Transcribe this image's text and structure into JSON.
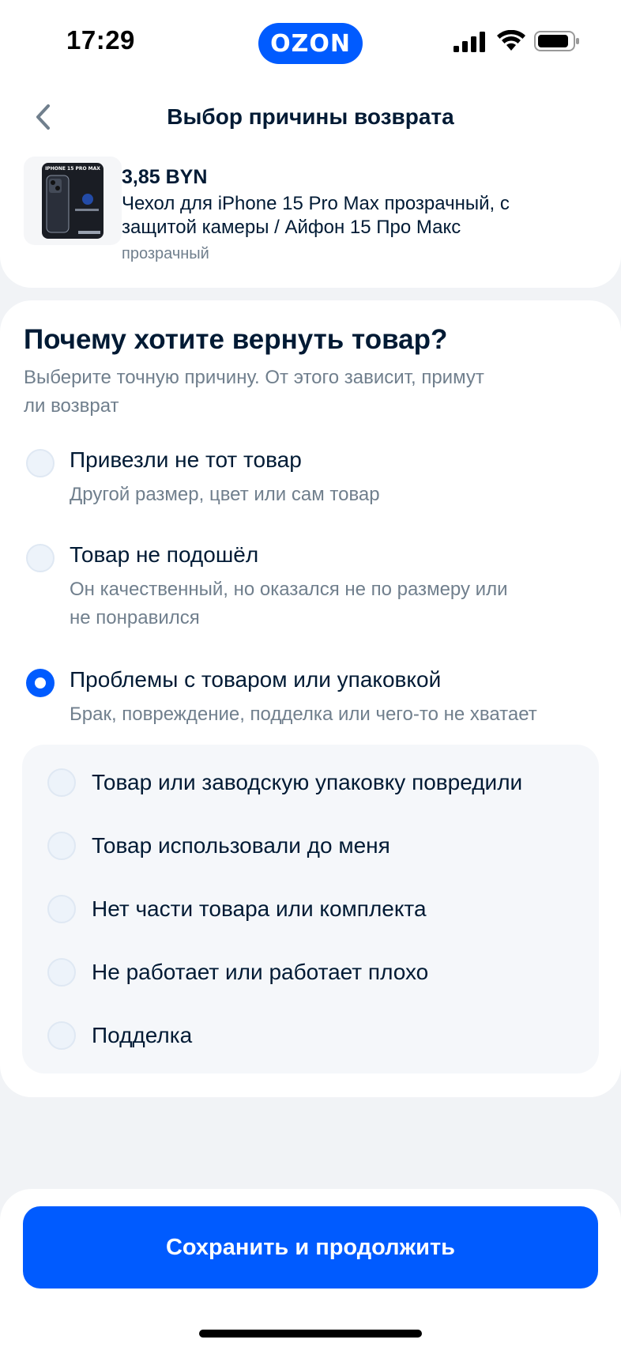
{
  "status_bar": {
    "time": "17:29",
    "brand": "OZON",
    "icons": [
      "signal-icon",
      "wifi-icon",
      "battery-icon"
    ]
  },
  "header": {
    "back_icon": "chevron-left-icon",
    "title": "Выбор причины возврата"
  },
  "product": {
    "price": "3,85 BYN",
    "name": "Чехол для iPhone 15 Pro Max прозрачный, с защитой камеры / Айфон 15 Про Макс",
    "variant": "прозрачный",
    "thumb_text": "IPHONE 15 PRO MAX"
  },
  "question": {
    "title": "Почему хотите вернуть товар?",
    "subtitle": "Выберите точную причину. От этого зависит, примут ли возврат",
    "options": [
      {
        "label": "Привезли не тот товар",
        "description": "Другой размер, цвет или сам товар",
        "selected": false
      },
      {
        "label": "Товар не подошёл",
        "description": "Он качественный, но оказался не по размеру или не понравился",
        "selected": false
      },
      {
        "label": "Проблемы с товаром или упаковкой",
        "description": "Брак, повреждение, подделка или чего-то не хватает",
        "selected": true
      }
    ],
    "sub_options": [
      {
        "label": "Товар или заводскую упаковку повредили"
      },
      {
        "label": "Товар использовали до меня"
      },
      {
        "label": "Нет части товара или комплекта"
      },
      {
        "label": "Не работает или работает плохо"
      },
      {
        "label": "Подделка"
      }
    ]
  },
  "footer": {
    "save_label": "Сохранить и продолжить"
  },
  "colors": {
    "accent": "#005bff",
    "text_primary": "#001a34",
    "text_secondary": "#707f8d",
    "background": "#f1f3f6"
  }
}
